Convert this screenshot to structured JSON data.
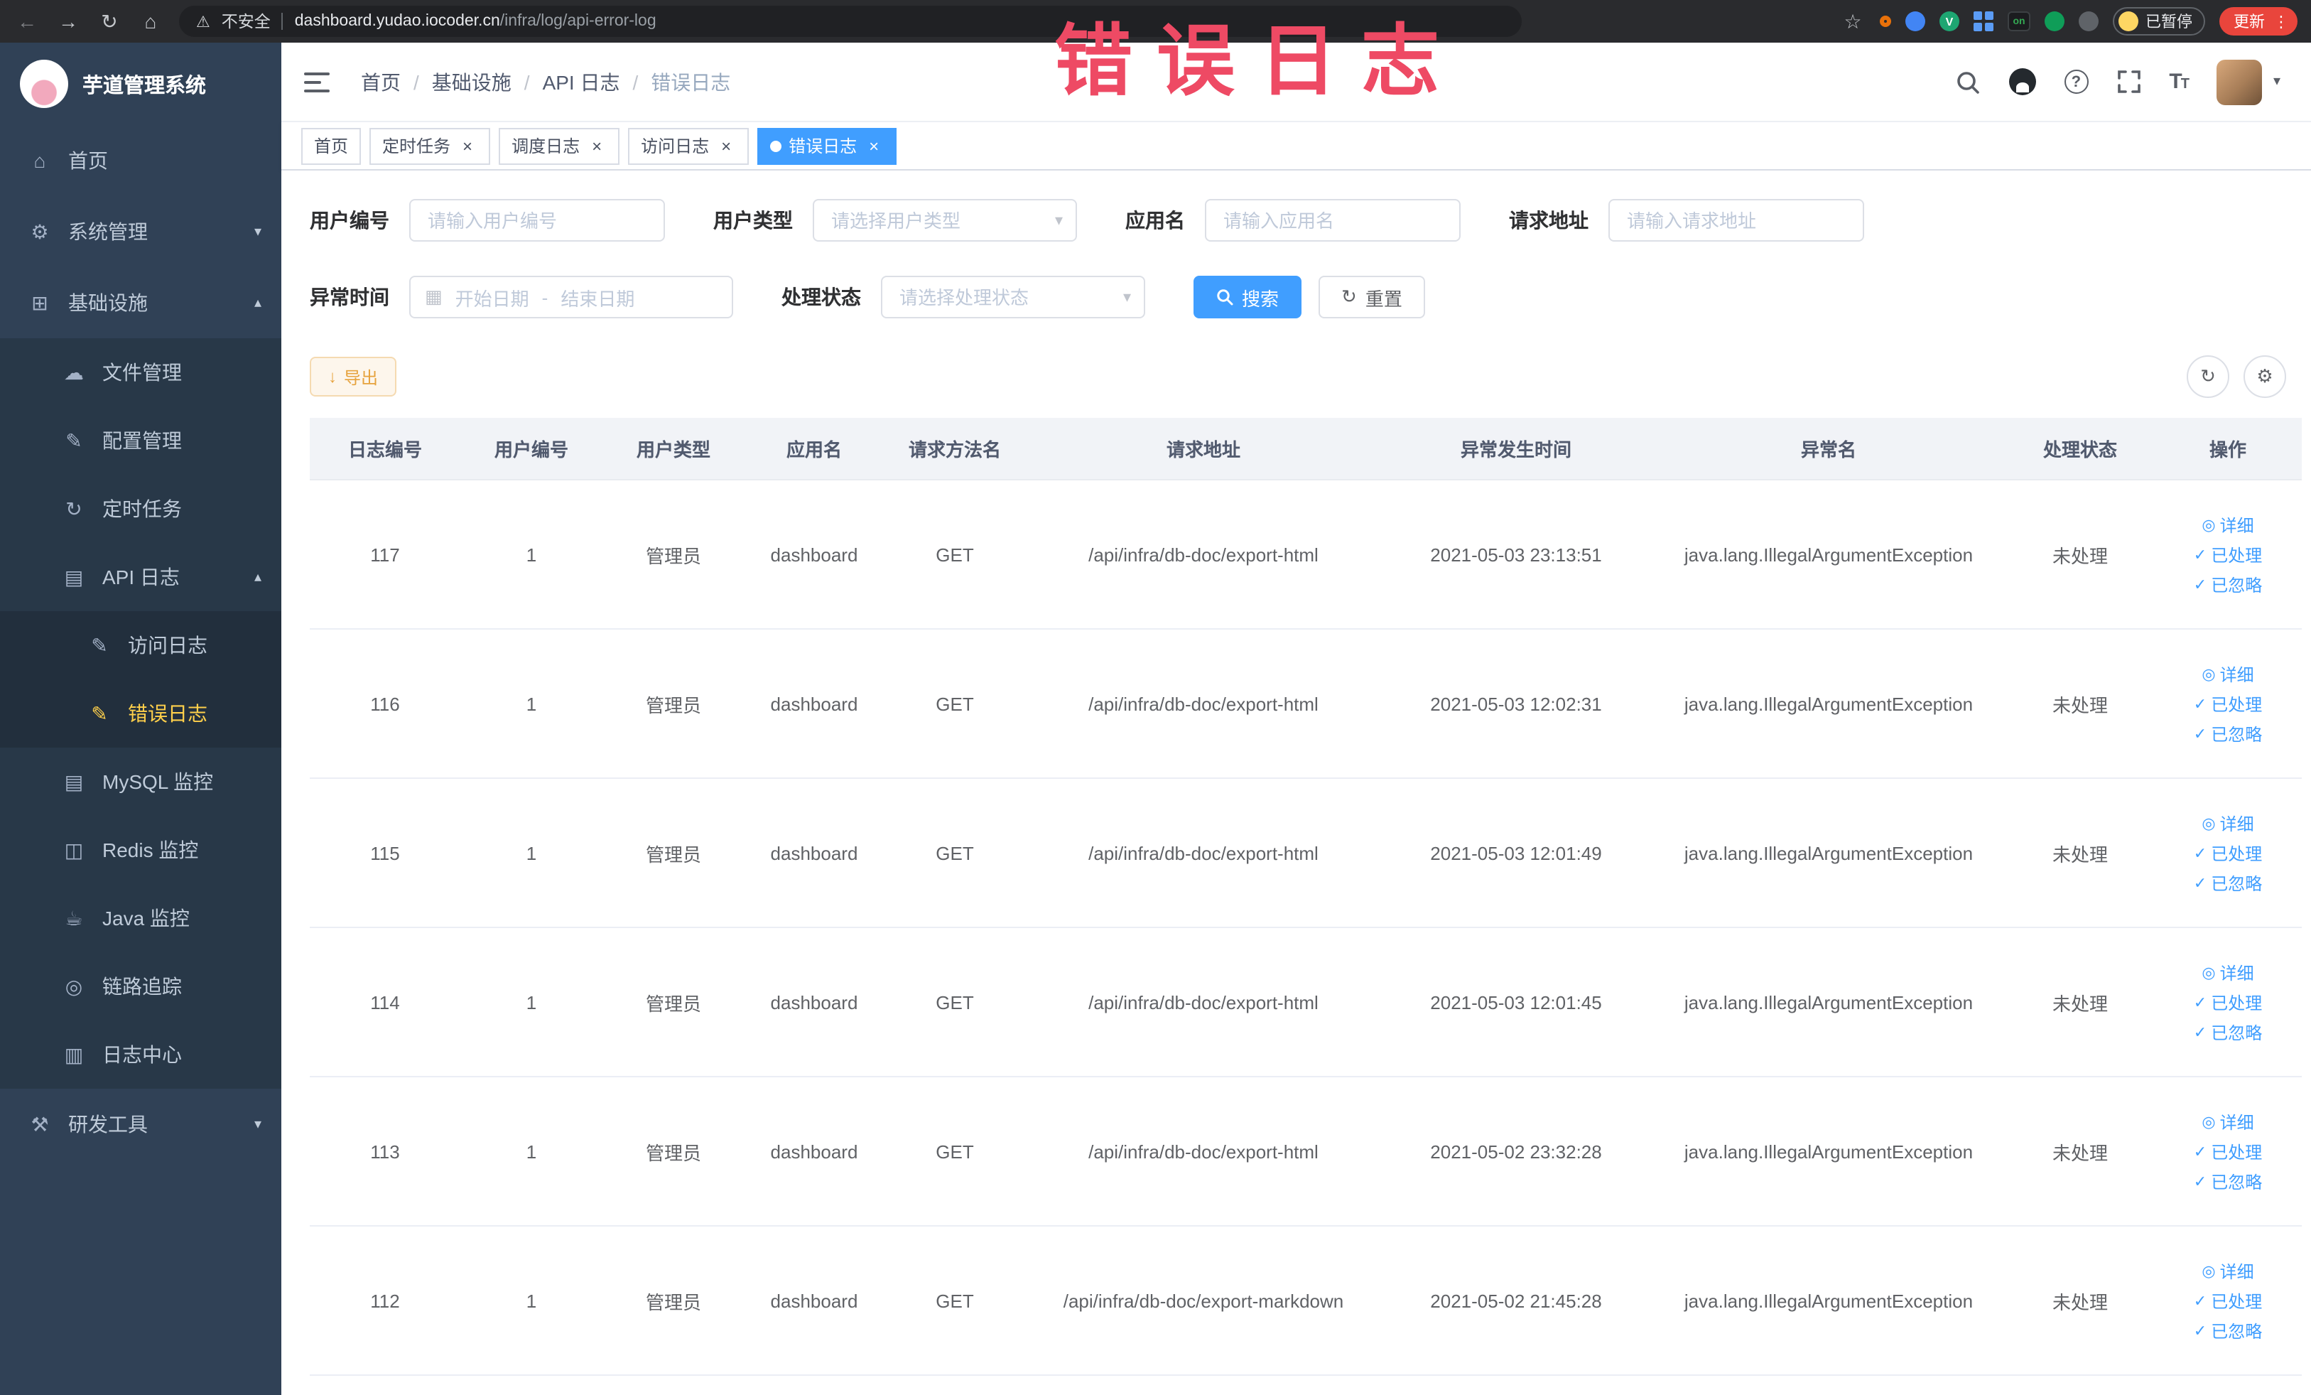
{
  "browser": {
    "security_label": "不安全",
    "url_host": "dashboard.yudao.iocoder.cn",
    "url_path": "/infra/log/api-error-log",
    "paused_label": "已暂停",
    "update_label": "更新"
  },
  "annotation": "错误日志",
  "sidebar": {
    "app_title": "芋道管理系统",
    "items": [
      {
        "label": "首页"
      },
      {
        "label": "系统管理"
      },
      {
        "label": "基础设施"
      },
      {
        "label": "文件管理"
      },
      {
        "label": "配置管理"
      },
      {
        "label": "定时任务"
      },
      {
        "label": "API 日志"
      },
      {
        "label": "访问日志"
      },
      {
        "label": "错误日志"
      },
      {
        "label": "MySQL 监控"
      },
      {
        "label": "Redis 监控"
      },
      {
        "label": "Java 监控"
      },
      {
        "label": "链路追踪"
      },
      {
        "label": "日志中心"
      },
      {
        "label": "研发工具"
      }
    ]
  },
  "navbar": {
    "breadcrumbs": [
      "首页",
      "基础设施",
      "API 日志",
      "错误日志"
    ]
  },
  "tabs": [
    {
      "label": "首页"
    },
    {
      "label": "定时任务"
    },
    {
      "label": "调度日志"
    },
    {
      "label": "访问日志"
    },
    {
      "label": "错误日志"
    }
  ],
  "filters": {
    "user_id_label": "用户编号",
    "user_id_placeholder": "请输入用户编号",
    "user_type_label": "用户类型",
    "user_type_placeholder": "请选择用户类型",
    "app_name_label": "应用名",
    "app_name_placeholder": "请输入应用名",
    "request_url_label": "请求地址",
    "request_url_placeholder": "请输入请求地址",
    "time_label": "异常时间",
    "time_start_placeholder": "开始日期",
    "time_separator": "-",
    "time_end_placeholder": "结束日期",
    "status_label": "处理状态",
    "status_placeholder": "请选择处理状态",
    "search_label": "搜索",
    "reset_label": "重置"
  },
  "toolbar": {
    "export_label": "导出"
  },
  "table": {
    "columns": [
      "日志编号",
      "用户编号",
      "用户类型",
      "应用名",
      "请求方法名",
      "请求地址",
      "异常发生时间",
      "异常名",
      "处理状态",
      "操作"
    ],
    "actions": [
      "详细",
      "已处理",
      "已忽略"
    ],
    "rows": [
      {
        "id": "117",
        "user_id": "1",
        "user_type": "管理员",
        "app": "dashboard",
        "method": "GET",
        "url": "/api/infra/db-doc/export-html",
        "time": "2021-05-03 23:13:51",
        "exception": "java.lang.IllegalArgumentException",
        "status": "未处理"
      },
      {
        "id": "116",
        "user_id": "1",
        "user_type": "管理员",
        "app": "dashboard",
        "method": "GET",
        "url": "/api/infra/db-doc/export-html",
        "time": "2021-05-03 12:02:31",
        "exception": "java.lang.IllegalArgumentException",
        "status": "未处理"
      },
      {
        "id": "115",
        "user_id": "1",
        "user_type": "管理员",
        "app": "dashboard",
        "method": "GET",
        "url": "/api/infra/db-doc/export-html",
        "time": "2021-05-03 12:01:49",
        "exception": "java.lang.IllegalArgumentException",
        "status": "未处理"
      },
      {
        "id": "114",
        "user_id": "1",
        "user_type": "管理员",
        "app": "dashboard",
        "method": "GET",
        "url": "/api/infra/db-doc/export-html",
        "time": "2021-05-03 12:01:45",
        "exception": "java.lang.IllegalArgumentException",
        "status": "未处理"
      },
      {
        "id": "113",
        "user_id": "1",
        "user_type": "管理员",
        "app": "dashboard",
        "method": "GET",
        "url": "/api/infra/db-doc/export-html",
        "time": "2021-05-02 23:32:28",
        "exception": "java.lang.IllegalArgumentException",
        "status": "未处理"
      },
      {
        "id": "112",
        "user_id": "1",
        "user_type": "管理员",
        "app": "dashboard",
        "method": "GET",
        "url": "/api/infra/db-doc/export-markdown",
        "time": "2021-05-02 21:45:28",
        "exception": "java.lang.IllegalArgumentException",
        "status": "未处理"
      }
    ]
  },
  "icons": {
    "back": "←",
    "forward": "→",
    "reload": "↻",
    "home": "⌂",
    "warning": "⚠",
    "star": "☆",
    "kebab": "⋮",
    "caret_down": "▾",
    "caret_up": "▴",
    "close": "×",
    "check": "✓",
    "eye": "◎",
    "menu_home": "⌂",
    "menu_system": "⚙",
    "menu_infra": "⊞",
    "menu_file": "☁",
    "menu_config": "✎",
    "menu_cron": "↻",
    "menu_api_log": "▤",
    "menu_doc": "✎",
    "menu_mysql": "▤",
    "menu_redis": "◫",
    "menu_java": "☕",
    "menu_trace": "◎",
    "menu_log_center": "▥",
    "menu_devtools": "⚒",
    "calendar": "▦",
    "download": "↓",
    "refresh": "↻",
    "gear": "⚙",
    "question": "?",
    "ext_v": "V",
    "ext_on": "on"
  }
}
